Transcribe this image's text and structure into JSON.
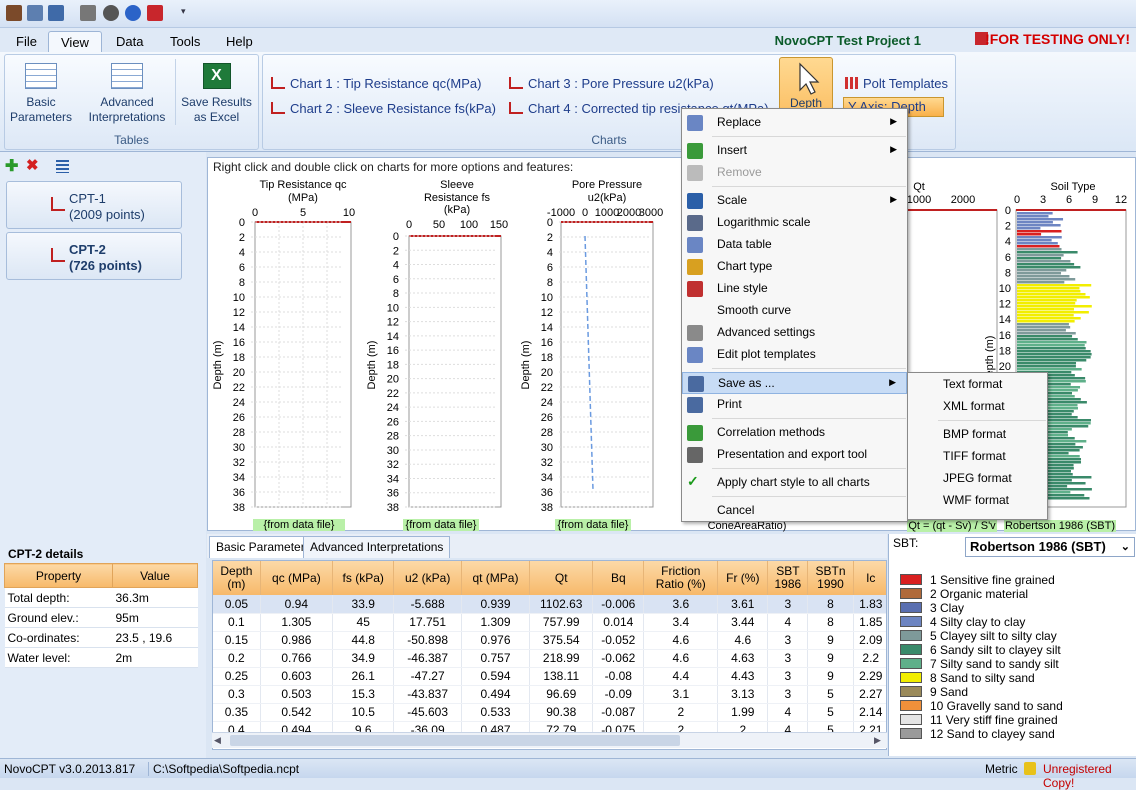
{
  "app": {
    "project_title": "NovoCPT Test Project 1",
    "testing_banner": "!FOR TESTING ONLY!"
  },
  "menu": [
    "File",
    "View",
    "Data",
    "Tools",
    "Help"
  ],
  "ribbon": {
    "tables_group": "Tables",
    "charts_group": "Charts",
    "basic_params": [
      "Basic",
      "Parameters"
    ],
    "adv_interp": [
      "Advanced",
      "Interpretations"
    ],
    "save_excel": [
      "Save Results",
      "as Excel"
    ],
    "chart1": "Chart 1 : Tip Resistance qc(MPa)",
    "chart2": "Chart 2 : Sleeve Resistance fs(kPa)",
    "chart3": "Chart 3 : Pore Pressure u2(kPa)",
    "chart4": "Chart 4 : Corrected tip resistance qt(MPa)",
    "depth": "Depth",
    "plot_templates": "Polt Templates",
    "y_axis": "Y Axis: Depth"
  },
  "cpts": [
    {
      "name": "CPT-1",
      "points": "(2009 points)"
    },
    {
      "name": "CPT-2",
      "points": "(726 points)"
    }
  ],
  "details": {
    "title": "CPT-2 details",
    "headers": [
      "Property",
      "Value"
    ],
    "rows": [
      [
        "Total depth:",
        "36.3m"
      ],
      [
        "Ground elev.:",
        "95m"
      ],
      [
        "Co-ordinates:",
        "23.5 , 19.6"
      ],
      [
        "Water level:",
        "2m"
      ]
    ]
  },
  "charts_hint": "Right click and double click on charts for more options and features:",
  "plots": {
    "qc": {
      "title1": "Tip Resistance qc",
      "title2": "(MPa)",
      "ticks": [
        "0",
        "5",
        "10"
      ],
      "footer": "{from data file}"
    },
    "fs": {
      "title1": "Sleeve",
      "title2": "Resistance fs",
      "title3": "(kPa)",
      "ticks": [
        "0",
        "50",
        "100",
        "150"
      ],
      "footer": "{from data file}"
    },
    "u2": {
      "title1": "Pore Pressure",
      "title2": "u2(kPa)",
      "ticks": [
        "-1000",
        "0",
        "1000",
        "2000",
        "3000"
      ],
      "footer": "{from data file}"
    },
    "qt": {
      "title1": "Qt",
      "ticks": [
        "1000",
        "2000"
      ],
      "footer": "Qt = (qt - Sv) / S'v"
    },
    "cone": {
      "footer": "ConeAreaRatio)"
    },
    "soil": {
      "title1": "Soil Type",
      "ticks": [
        "0",
        "3",
        "6",
        "9",
        "12"
      ],
      "footer": "Robertson 1986 (SBT)"
    },
    "depth_label": "Depth (m)",
    "depth_ticks": [
      "0",
      "2",
      "4",
      "6",
      "8",
      "10",
      "12",
      "14",
      "16",
      "18",
      "20",
      "22",
      "24",
      "26",
      "28",
      "30",
      "32",
      "34",
      "36",
      "38"
    ],
    "soil_ticks": [
      "0",
      "2",
      "4",
      "6",
      "8",
      "10",
      "12",
      "14",
      "16",
      "18",
      "20",
      "22",
      "24",
      "26",
      "28",
      "30",
      "32",
      "34",
      "36"
    ]
  },
  "tabs": [
    "Basic Parameters",
    "Advanced Interpretations"
  ],
  "grid": {
    "headers": [
      [
        "Depth",
        "(m)"
      ],
      [
        "qc (MPa)"
      ],
      [
        "fs (kPa)"
      ],
      [
        "u2 (kPa)"
      ],
      [
        "qt (MPa)"
      ],
      [
        "Qt"
      ],
      [
        "Bq"
      ],
      [
        "Friction",
        "Ratio (%)"
      ],
      [
        "Fr (%)"
      ],
      [
        "SBT",
        "1986"
      ],
      [
        "SBTn",
        "1990"
      ],
      [
        "Ic"
      ]
    ],
    "rows": [
      [
        "0.05",
        "0.94",
        "33.9",
        "-5.688",
        "0.939",
        "1102.63",
        "-0.006",
        "3.6",
        "3.61",
        "3",
        "8",
        "1.83"
      ],
      [
        "0.1",
        "1.305",
        "45",
        "17.751",
        "1.309",
        "757.99",
        "0.014",
        "3.4",
        "3.44",
        "4",
        "8",
        "1.85"
      ],
      [
        "0.15",
        "0.986",
        "44.8",
        "-50.898",
        "0.976",
        "375.54",
        "-0.052",
        "4.6",
        "4.6",
        "3",
        "9",
        "2.09"
      ],
      [
        "0.2",
        "0.766",
        "34.9",
        "-46.387",
        "0.757",
        "218.99",
        "-0.062",
        "4.6",
        "4.63",
        "3",
        "9",
        "2.2"
      ],
      [
        "0.25",
        "0.603",
        "26.1",
        "-47.27",
        "0.594",
        "138.11",
        "-0.08",
        "4.4",
        "4.43",
        "3",
        "9",
        "2.29"
      ],
      [
        "0.3",
        "0.503",
        "15.3",
        "-43.837",
        "0.494",
        "96.69",
        "-0.09",
        "3.1",
        "3.13",
        "3",
        "5",
        "2.27"
      ],
      [
        "0.35",
        "0.542",
        "10.5",
        "-45.603",
        "0.533",
        "90.38",
        "-0.087",
        "2",
        "1.99",
        "4",
        "5",
        "2.14"
      ],
      [
        "0.4",
        "0.494",
        "9.6",
        "-36.09",
        "0.487",
        "72.79",
        "-0.075",
        "2",
        "2",
        "4",
        "5",
        "2.21"
      ]
    ]
  },
  "sbt": {
    "label": "SBT:",
    "selected": "Robertson 1986 (SBT)",
    "legend": [
      {
        "label": "1 Sensitive fine grained",
        "color": "#d92020"
      },
      {
        "label": "2 Organic material",
        "color": "#b06a3a"
      },
      {
        "label": "3 Clay",
        "color": "#5a6fb0"
      },
      {
        "label": "4 Silty clay to clay",
        "color": "#6d85c2"
      },
      {
        "label": "5 Clayey silt to silty clay",
        "color": "#7e9a9a"
      },
      {
        "label": "6 Sandy silt to clayey silt",
        "color": "#3a8a6a"
      },
      {
        "label": "7 Silty sand to sandy silt",
        "color": "#5fb08a"
      },
      {
        "label": "8 Sand to silty sand",
        "color": "#f2ee00"
      },
      {
        "label": "9 Sand",
        "color": "#9a8a5a"
      },
      {
        "label": "10 Gravelly sand to sand",
        "color": "#f0903a"
      },
      {
        "label": "11 Very stiff fine grained",
        "color": "#e4e4e4"
      },
      {
        "label": "12 Sand to clayey sand",
        "color": "#9a9a9a"
      }
    ]
  },
  "context_menu": {
    "items": [
      "Replace",
      "Insert",
      "Remove",
      "Scale",
      "Logarithmic scale",
      "Data table",
      "Chart type",
      "Line style",
      "Smooth curve",
      "Advanced settings",
      "Edit plot templates",
      "Save as ...",
      "Print",
      "Correlation methods",
      "Presentation and export tool",
      "Apply chart style to all charts",
      "Cancel"
    ],
    "submenu": [
      "Text format",
      "XML format",
      "BMP format",
      "TIFF format",
      "JPEG format",
      "WMF format"
    ]
  },
  "status": {
    "version": "NovoCPT v3.0.2013.817",
    "path": "C:\\Softpedia\\Softpedia.ncpt",
    "units": "Metric",
    "license": "Unregistered Copy!"
  }
}
